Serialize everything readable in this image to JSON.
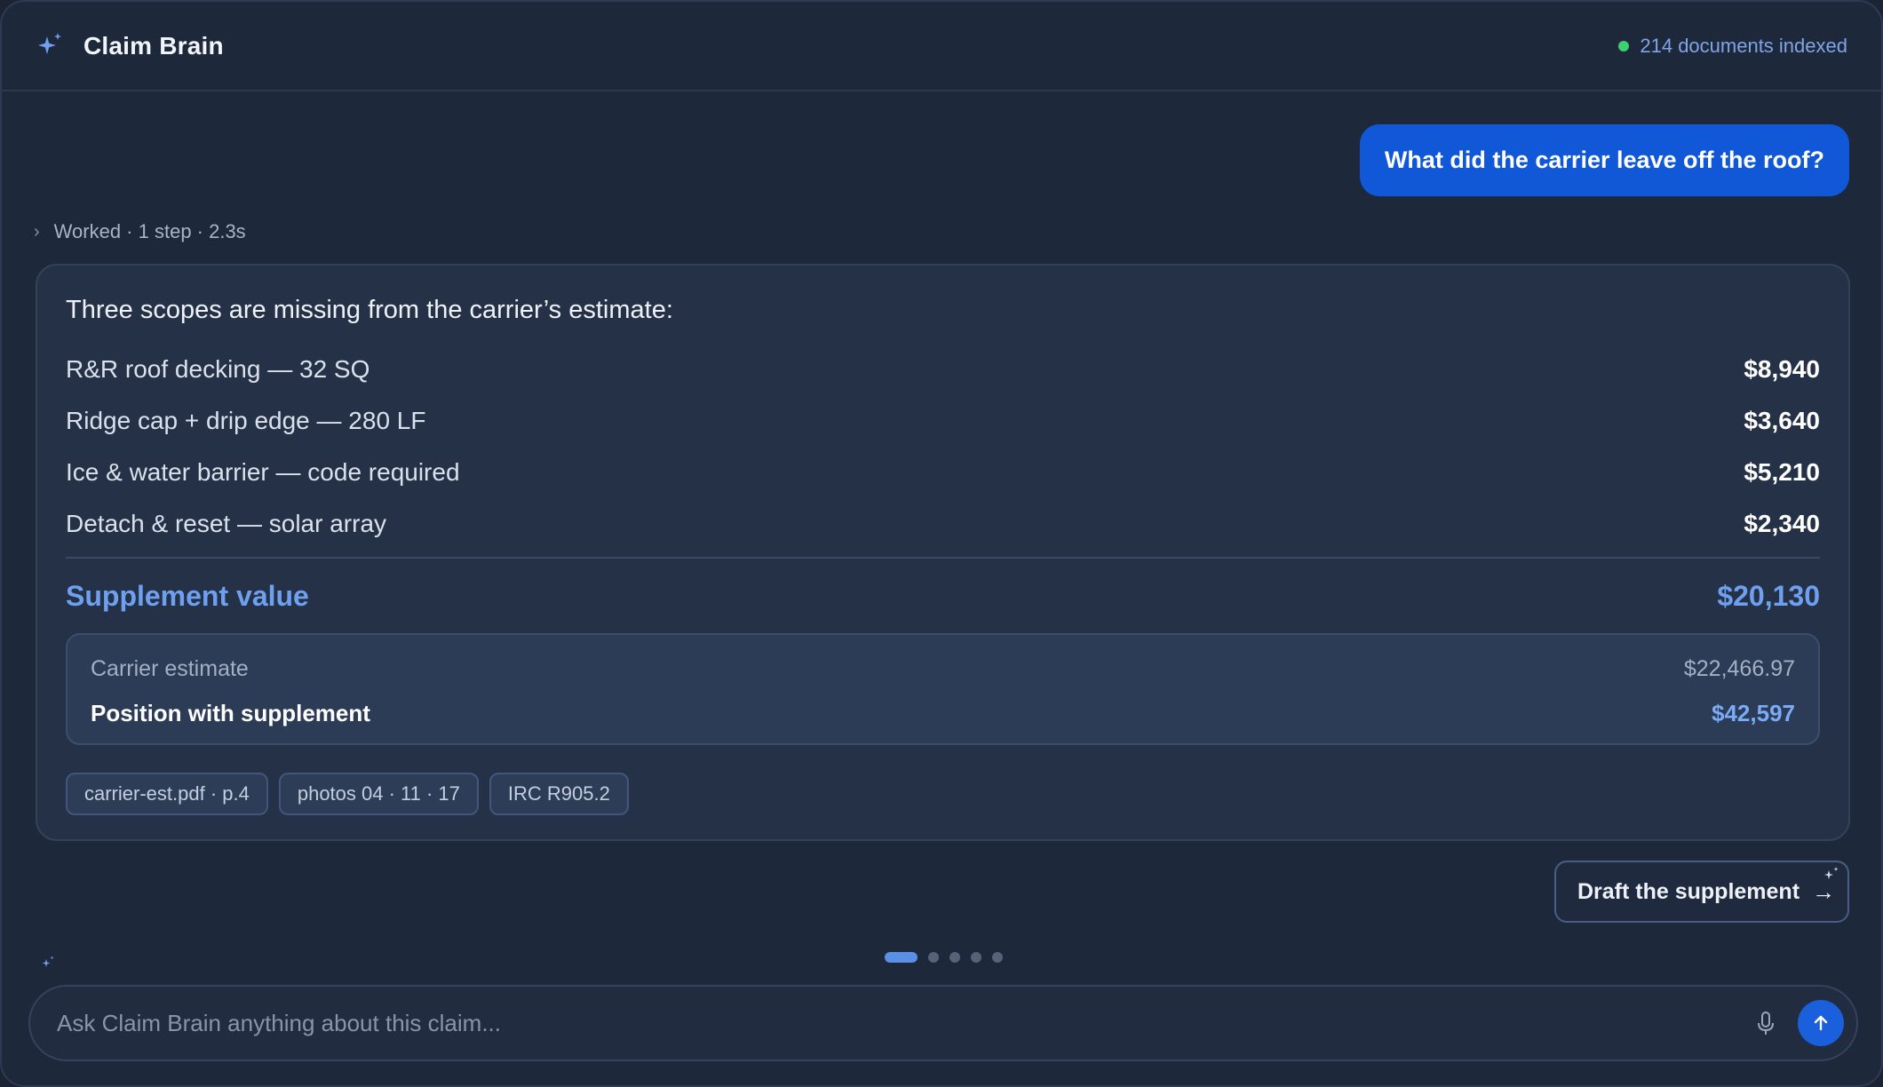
{
  "header": {
    "title": "Claim Brain",
    "logo_icon": "sparkle-icon",
    "status_text": "214 documents indexed",
    "status_color": "#3ecf73"
  },
  "conversation": {
    "user_message": "What did the carrier leave off the roof?",
    "worked_summary": "Worked · 1 step · 2.3s",
    "answer": {
      "intro": "Three scopes are missing from the carrier’s estimate:",
      "line_items": [
        {
          "label": "R&R roof decking — 32 SQ",
          "amount": "$8,940"
        },
        {
          "label": "Ridge cap + drip edge — 280 LF",
          "amount": "$3,640"
        },
        {
          "label": "Ice & water barrier — code required",
          "amount": "$5,210"
        },
        {
          "label": "Detach & reset — solar array",
          "amount": "$2,340"
        }
      ],
      "supplement_label": "Supplement value",
      "supplement_value": "$20,130",
      "carrier_estimate_label": "Carrier estimate",
      "carrier_estimate_value": "$22,466.97",
      "position_label": "Position with supplement",
      "position_value": "$42,597",
      "sources": [
        "carrier-est.pdf · p.4",
        "photos 04 · 11 · 17",
        "IRC R905.2"
      ]
    },
    "action_button": "Draft the supplement"
  },
  "pager": {
    "count": 5,
    "active": 0
  },
  "composer": {
    "placeholder": "Ask Claim Brain anything about this claim...",
    "value": ""
  },
  "colors": {
    "accent": "#1158d8",
    "supplement": "#6ea0ef",
    "background": "#1e283b",
    "card": "#253146"
  }
}
